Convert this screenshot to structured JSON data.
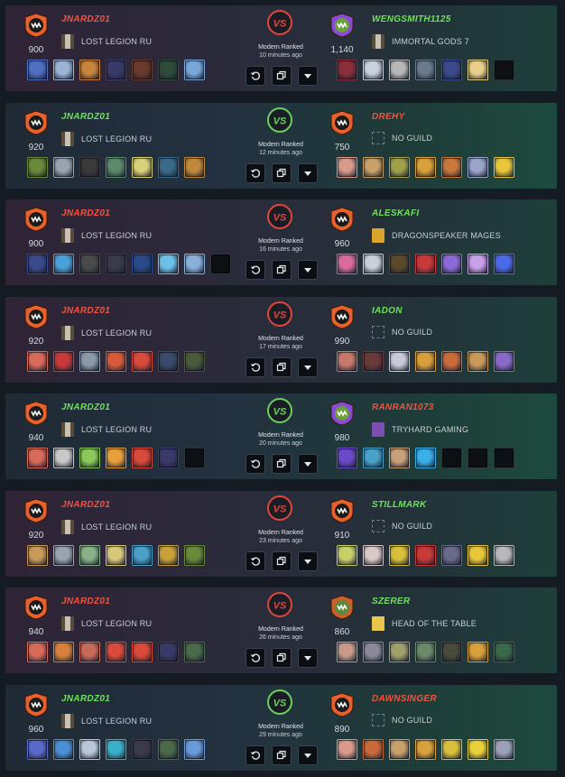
{
  "matches": [
    {
      "result": "loss",
      "mode": "Modern Ranked",
      "ago": "10 minutes ago",
      "left": {
        "name": "JNARDZ01",
        "rating": "900",
        "guild": "LOST LEGION RU",
        "guild_icon": "banner",
        "color": "red",
        "heroes": [
          "#4f6fc1",
          "#9bb4d6",
          "#c8843c",
          "#3a3a6a",
          "#6a3a2a",
          "#2f4b3a",
          "#7aa6d8"
        ]
      },
      "right": {
        "name": "WENGSMITH1125",
        "rating": "1,140",
        "guild": "IMMORTAL GODS 7",
        "guild_icon": "banner",
        "color": "green",
        "emblem": "purple",
        "heroes": [
          "#8a2e3a",
          "#c9d1da",
          "#b8b8b8",
          "#6a7a8a",
          "#3a4a8a",
          "#e8d08a",
          null
        ]
      }
    },
    {
      "result": "win",
      "mode": "Modern Ranked",
      "ago": "12 minutes ago",
      "left": {
        "name": "JNARDZ01",
        "rating": "920",
        "guild": "LOST LEGION RU",
        "guild_icon": "banner",
        "color": "green",
        "heroes": [
          "#6a8a3a",
          "#9aa3b0",
          "#3a3a3a",
          "#5a8a6a",
          "#d9d07a",
          "#3a6a8a",
          "#c08a3a"
        ]
      },
      "right": {
        "name": "DREHY",
        "rating": "750",
        "guild": "NO GUILD",
        "guild_icon": "none",
        "color": "red",
        "heroes": [
          "#d89a8a",
          "#c8a06a",
          "#a0a04a",
          "#d8a03a",
          "#c8783a",
          "#9aa3c8",
          "#e8c83a"
        ]
      }
    },
    {
      "result": "loss",
      "mode": "Modern Ranked",
      "ago": "16 minutes ago",
      "left": {
        "name": "JNARDZ01",
        "rating": "900",
        "guild": "LOST LEGION RU",
        "guild_icon": "banner",
        "color": "red",
        "heroes": [
          "#3a4a8a",
          "#4aa0d8",
          "#4a4a4a",
          "#3a3a4a",
          "#2a4a8a",
          "#6ac0e8",
          "#8ab0d8",
          null
        ]
      },
      "right": {
        "name": "ALESKAFI",
        "rating": "960",
        "guild": "DRAGONSPEAKER MAGES",
        "guild_icon": "gold",
        "color": "green",
        "heroes": [
          "#d86aa0",
          "#c8d0d8",
          "#5a4a2a",
          "#c83a3a",
          "#8a6ad8",
          "#c8a0e8",
          "#4a6ae8"
        ]
      }
    },
    {
      "result": "loss",
      "mode": "Modern Ranked",
      "ago": "17 minutes ago",
      "left": {
        "name": "JNARDZ01",
        "rating": "920",
        "guild": "LOST LEGION RU",
        "guild_icon": "banner",
        "color": "red",
        "heroes": [
          "#d86a5a",
          "#c83a3a",
          "#8a9aa8",
          "#d85a3a",
          "#d84a3a",
          "#3a4a6a",
          "#4a5a3a"
        ]
      },
      "right": {
        "name": "IADON",
        "rating": "990",
        "guild": "NO GUILD",
        "guild_icon": "none",
        "color": "green",
        "heroes": [
          "#c87a6a",
          "#6a3a3a",
          "#c8c8d8",
          "#d8a03a",
          "#c86a3a",
          "#c89a5a",
          "#8a6ac8"
        ]
      }
    },
    {
      "result": "win",
      "mode": "Modern Ranked",
      "ago": "20 minutes ago",
      "left": {
        "name": "JNARDZ01",
        "rating": "940",
        "guild": "LOST LEGION RU",
        "guild_icon": "banner",
        "color": "green",
        "heroes": [
          "#d86a5a",
          "#c8c8c8",
          "#8ac85a",
          "#e8a03a",
          "#d84a3a",
          "#3a3a6a",
          null
        ]
      },
      "right": {
        "name": "RANRAN1073",
        "rating": "980",
        "guild": "TRYHARD GAMING",
        "guild_icon": "purple",
        "color": "red",
        "emblem": "purple",
        "heroes": [
          "#6a4ac8",
          "#4aa0c8",
          "#c8a07a",
          "#3ab0e8",
          null,
          null,
          null
        ]
      }
    },
    {
      "result": "loss",
      "mode": "Modern Ranked",
      "ago": "23 minutes ago",
      "left": {
        "name": "JNARDZ01",
        "rating": "920",
        "guild": "LOST LEGION RU",
        "guild_icon": "banner",
        "color": "red",
        "heroes": [
          "#c89a5a",
          "#9aa3b0",
          "#8ab08a",
          "#d8c87a",
          "#4aa0c8",
          "#c8a03a",
          "#6a8a3a"
        ]
      },
      "right": {
        "name": "STILLMARK",
        "rating": "910",
        "guild": "NO GUILD",
        "guild_icon": "none",
        "color": "green",
        "heroes": [
          "#c8d06a",
          "#d8c8c8",
          "#d8c03a",
          "#c83a3a",
          "#6a6a8a",
          "#e8c83a",
          "#b8b8b8"
        ]
      }
    },
    {
      "result": "loss",
      "mode": "Modern Ranked",
      "ago": "26 minutes ago",
      "left": {
        "name": "JNARDZ01",
        "rating": "940",
        "guild": "LOST LEGION RU",
        "guild_icon": "banner",
        "color": "red",
        "heroes": [
          "#d86a5a",
          "#d8803a",
          "#c86a5a",
          "#d84a3a",
          "#d84a3a",
          "#3a3a6a",
          "#4a6a4a"
        ]
      },
      "right": {
        "name": "SZERER",
        "rating": "860",
        "guild": "HEAD OF THE TABLE",
        "guild_icon": "yellow",
        "color": "green",
        "emblem": "green",
        "heroes": [
          "#c89a8a",
          "#8a8a9a",
          "#a0a06a",
          "#6a8a6a",
          "#4a4a3a",
          "#d8a03a",
          "#3a6a4a"
        ]
      }
    },
    {
      "result": "win",
      "mode": "Modern Ranked",
      "ago": "29 minutes ago",
      "left": {
        "name": "JNARDZ01",
        "rating": "960",
        "guild": "LOST LEGION RU",
        "guild_icon": "banner",
        "color": "green",
        "heroes": [
          "#5a6ac8",
          "#4a90d8",
          "#b8c8d8",
          "#3ab0c8",
          "#3a3a4a",
          "#4a6a4a",
          "#6a9ad8"
        ]
      },
      "right": {
        "name": "DAWNSINGER",
        "rating": "890",
        "guild": "NO GUILD",
        "guild_icon": "none",
        "color": "red",
        "heroes": [
          "#d89a8a",
          "#c86a3a",
          "#c8a06a",
          "#d8a03a",
          "#d8c03a",
          "#e8d03a",
          "#9aa0b8"
        ]
      }
    }
  ],
  "colors": {
    "loss": "#e0463a",
    "win": "#6bd15a",
    "emblem_orange": "#e8602c"
  }
}
